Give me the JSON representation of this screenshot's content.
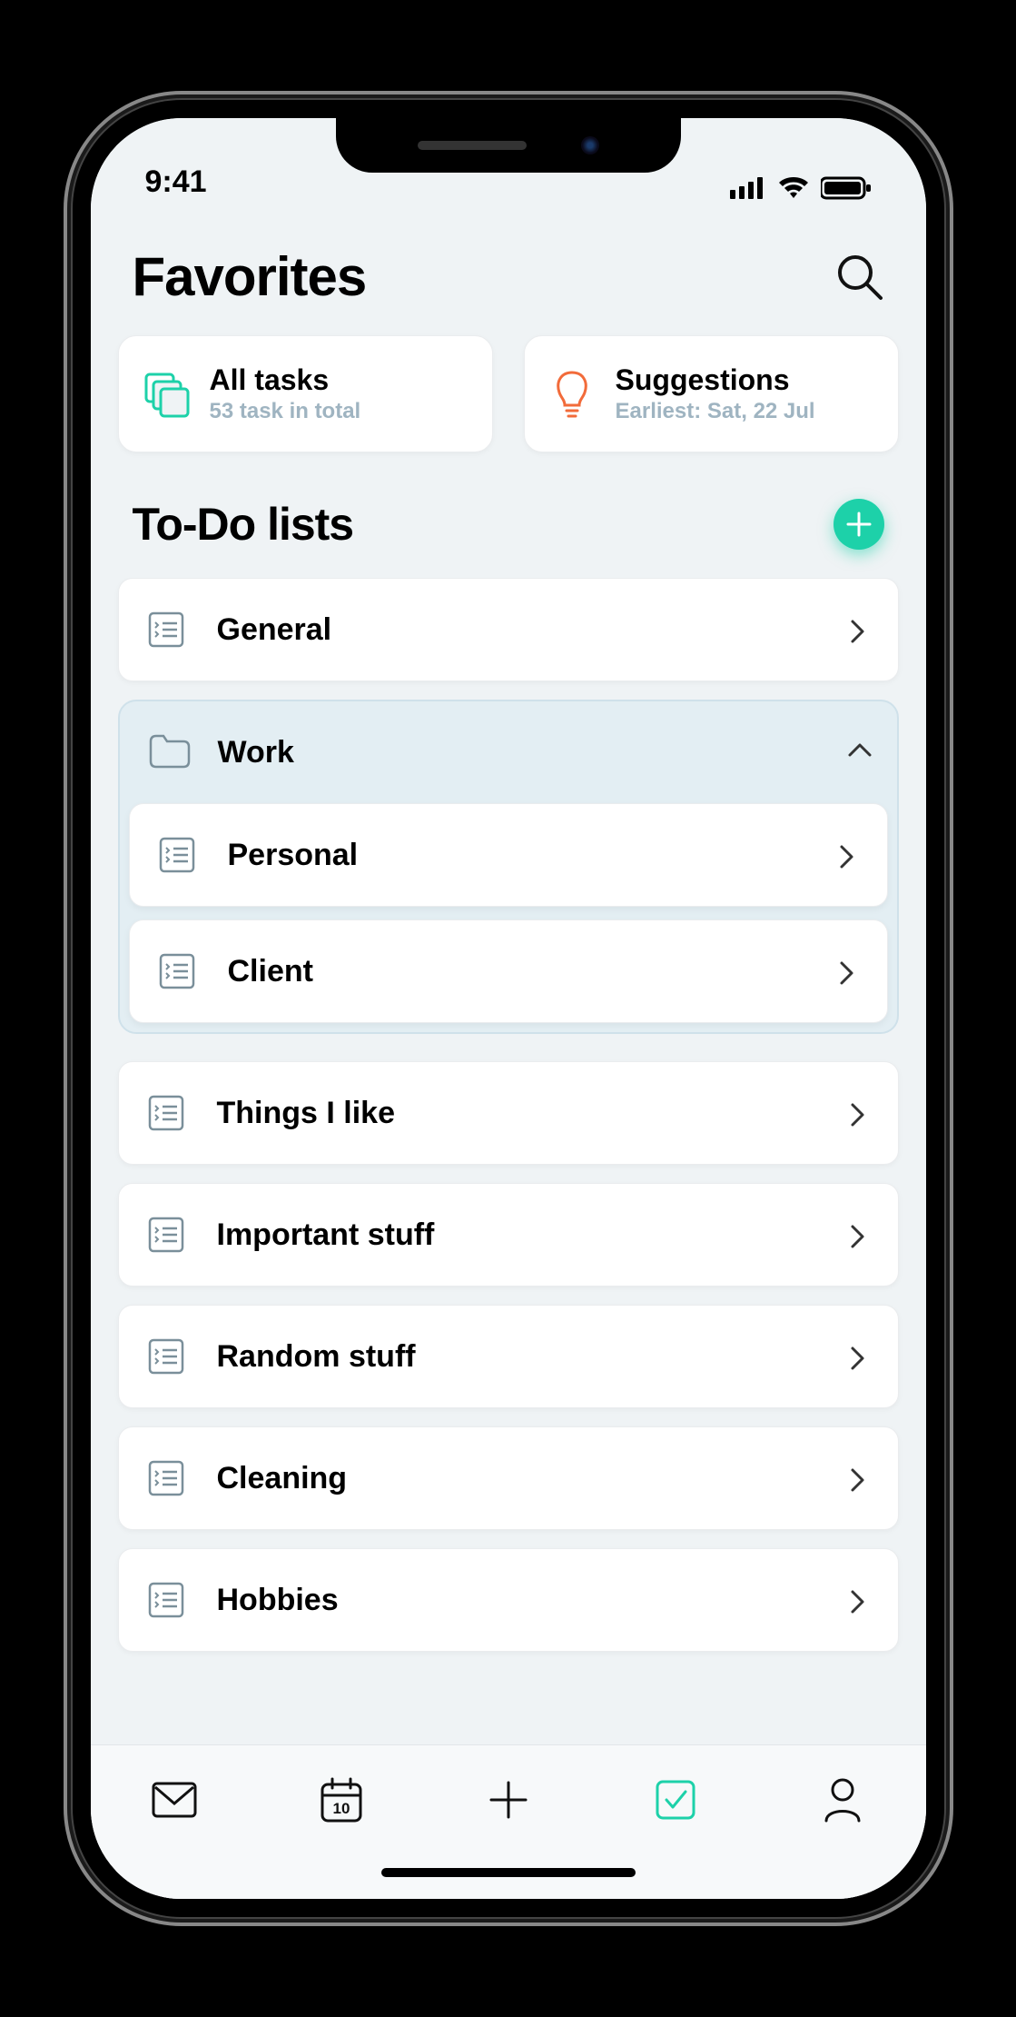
{
  "status": {
    "time": "9:41"
  },
  "header": {
    "title": "Favorites"
  },
  "cards": {
    "all_tasks": {
      "icon": "stack-icon",
      "title": "All tasks",
      "subtitle": "53 task in total"
    },
    "suggestions": {
      "icon": "bulb-icon",
      "title": "Suggestions",
      "subtitle": "Earliest: Sat, 22 Jul"
    }
  },
  "section": {
    "title": "To-Do lists"
  },
  "lists": [
    {
      "type": "list",
      "label": "General"
    },
    {
      "type": "folder",
      "label": "Work",
      "expanded": true,
      "children": [
        {
          "type": "list",
          "label": "Personal"
        },
        {
          "type": "list",
          "label": "Client"
        }
      ]
    },
    {
      "type": "list",
      "label": "Things I like"
    },
    {
      "type": "list",
      "label": "Important stuff"
    },
    {
      "type": "list",
      "label": "Random stuff"
    },
    {
      "type": "list",
      "label": "Cleaning"
    },
    {
      "type": "list",
      "label": "Hobbies"
    }
  ],
  "tabs": {
    "calendar_badge": "10"
  }
}
